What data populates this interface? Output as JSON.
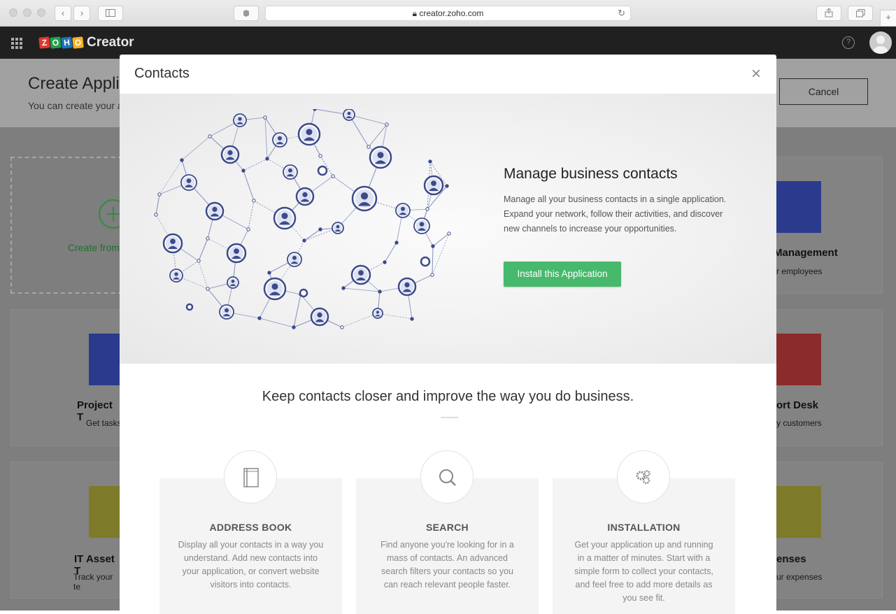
{
  "browser": {
    "url": "creator.zoho.com",
    "new_tab_label": "+"
  },
  "app": {
    "logo_letters": [
      "Z",
      "O",
      "H",
      "O"
    ],
    "logo_word": "Creator",
    "help_label": "?"
  },
  "page": {
    "title": "Create Appli",
    "subtitle": "You can create your a",
    "cancel_label": "Cancel",
    "tiles": [
      {
        "name": "Create from",
        "desc": ""
      },
      {
        "name": "Management",
        "desc": "r employees"
      },
      {
        "name": "Project T",
        "desc": "Get tasks"
      },
      {
        "name": "ort Desk",
        "desc": "y customers"
      },
      {
        "name": "IT Asset T",
        "desc": "Track your te"
      },
      {
        "name": "enses",
        "desc": "ur expenses"
      }
    ]
  },
  "modal": {
    "title": "Contacts",
    "close_label": "×",
    "hero": {
      "title": "Manage business contacts",
      "text": "Manage all your business contacts in a single application. Expand your network, follow their activities, and discover new channels to increase your opportunities.",
      "install_label": "Install this Application"
    },
    "tagline": "Keep contacts closer and improve the way you do business.",
    "features": [
      {
        "icon": "address-book-icon",
        "title": "ADDRESS BOOK",
        "text": "Display all your contacts in a way you understand. Add new contacts into your application, or convert website visitors into contacts."
      },
      {
        "icon": "search-icon",
        "title": "SEARCH",
        "text": "Find anyone you're looking for in a mass of contacts. An advanced search filters your contacts so you can reach relevant people faster."
      },
      {
        "icon": "gears-icon",
        "title": "INSTALLATION",
        "text": "Get your application up and running in a matter of minutes. Start with a simple form to collect your contacts, and feel free to add more details as you see fit."
      }
    ]
  },
  "colors": {
    "accent_green": "#47b96c",
    "network_blue": "#3d4a8a",
    "tile_blue": "#2b3a8c",
    "tile_red": "#8b2b2b",
    "tile_olive": "#7d7a2a"
  }
}
